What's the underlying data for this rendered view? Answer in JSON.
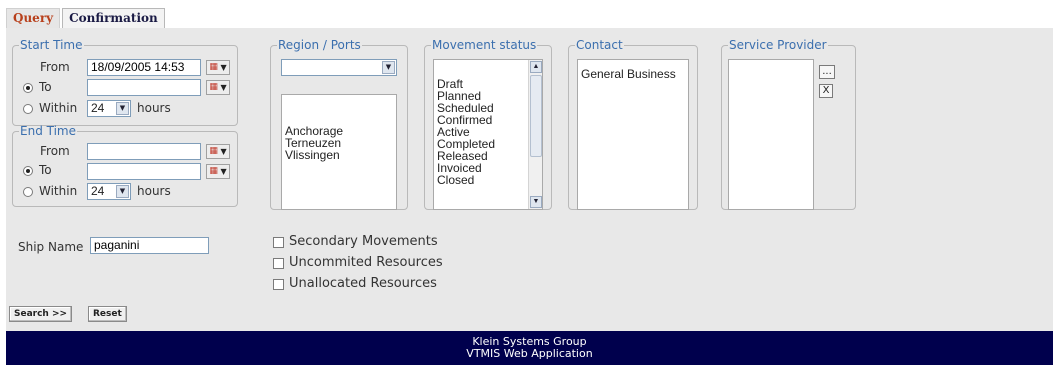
{
  "tabs": [
    {
      "label": "Query",
      "active": true
    },
    {
      "label": "Confirmation",
      "active": false
    }
  ],
  "start_time": {
    "legend": "Start Time",
    "from_label": "From",
    "from_value": "18/09/2005 14:53",
    "to_label": "To",
    "to_value": "",
    "within_label": "Within",
    "within_value": "24",
    "hours_label": "hours",
    "selected_mode": "to"
  },
  "end_time": {
    "legend": "End Time",
    "from_label": "From",
    "from_value": "",
    "to_label": "To",
    "to_value": "",
    "within_label": "Within",
    "within_value": "24",
    "hours_label": "hours",
    "selected_mode": "to"
  },
  "region_ports": {
    "legend": "Region / Ports",
    "region_value": "",
    "ports": [
      "Anchorage",
      "Terneuzen",
      "Vlissingen"
    ]
  },
  "movement_status": {
    "legend": "Movement status",
    "items": [
      "Draft",
      "Planned",
      "Scheduled",
      "Confirmed",
      "Active",
      "Completed",
      "Released",
      "Invoiced",
      "Closed"
    ]
  },
  "contact": {
    "legend": "Contact",
    "items": [
      "General Business"
    ]
  },
  "service_provider": {
    "legend": "Service Provider",
    "items": [],
    "browse_label": "...",
    "clear_label": "X"
  },
  "ship_name": {
    "label": "Ship Name",
    "value": "paganini"
  },
  "options": [
    {
      "label": "Secondary Movements",
      "checked": false
    },
    {
      "label": "Uncommited Resources",
      "checked": false
    },
    {
      "label": "Unallocated Resources",
      "checked": false
    }
  ],
  "buttons": {
    "search": "Search >>",
    "reset": "Reset"
  },
  "footer": {
    "line1": "Klein Systems Group",
    "line2": "VTMIS Web Application"
  },
  "colors": {
    "panel_bg": "#e8e8e8",
    "legend_text": "#3b6fae",
    "active_tab_text": "#b8401c",
    "footer_bg": "#00004d"
  }
}
